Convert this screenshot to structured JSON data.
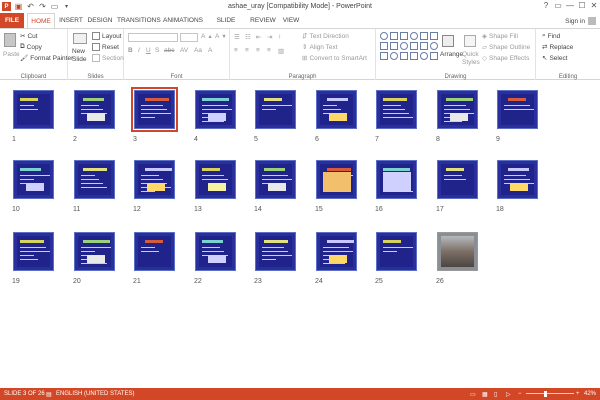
{
  "window": {
    "title": "ashae_uray [Compatibility Mode] - PowerPoint",
    "help": "?",
    "controls": [
      "▭",
      "—",
      "☐",
      "✕"
    ]
  },
  "account": {
    "label": "Sign in"
  },
  "tabs": [
    {
      "id": "file",
      "label": "FILE"
    },
    {
      "id": "home",
      "label": "HOME"
    },
    {
      "id": "insert",
      "label": "INSERT"
    },
    {
      "id": "design",
      "label": "DESIGN"
    },
    {
      "id": "transitions",
      "label": "TRANSITIONS"
    },
    {
      "id": "animations",
      "label": "ANIMATIONS"
    },
    {
      "id": "slideshow",
      "label": "SLIDE SHOW"
    },
    {
      "id": "review",
      "label": "REVIEW"
    },
    {
      "id": "view",
      "label": "VIEW"
    }
  ],
  "ribbon": {
    "clipboard": {
      "group": "Clipboard",
      "paste": "Paste",
      "cut": "Cut",
      "copy": "Copy",
      "format_painter": "Format Painter"
    },
    "slides": {
      "group": "Slides",
      "new_slide": "New",
      "new_slide_2": "Slide",
      "layout": "Layout",
      "reset": "Reset",
      "section": "Section"
    },
    "font": {
      "group": "Font",
      "aa": "Aa"
    },
    "paragraph": {
      "group": "Paragraph",
      "text_direction": "Text Direction",
      "align_text": "Align Text",
      "convert": "Convert to SmartArt"
    },
    "drawing": {
      "group": "Drawing",
      "arrange": "Arrange",
      "quick_styles": "Quick",
      "quick_styles_2": "Styles",
      "shape_fill": "Shape Fill",
      "shape_outline": "Shape Outline",
      "shape_effects": "Shape Effects"
    },
    "editing": {
      "group": "Editing",
      "find": "Find",
      "replace": "Replace",
      "select": "Select"
    }
  },
  "slides": [
    {
      "n": "1"
    },
    {
      "n": "2"
    },
    {
      "n": "3"
    },
    {
      "n": "4"
    },
    {
      "n": "5"
    },
    {
      "n": "6"
    },
    {
      "n": "7"
    },
    {
      "n": "8"
    },
    {
      "n": "9"
    },
    {
      "n": "10"
    },
    {
      "n": "11"
    },
    {
      "n": "12"
    },
    {
      "n": "13"
    },
    {
      "n": "14"
    },
    {
      "n": "15"
    },
    {
      "n": "16"
    },
    {
      "n": "17"
    },
    {
      "n": "18"
    },
    {
      "n": "19"
    },
    {
      "n": "20"
    },
    {
      "n": "21"
    },
    {
      "n": "22"
    },
    {
      "n": "23"
    },
    {
      "n": "24"
    },
    {
      "n": "25"
    },
    {
      "n": "26"
    }
  ],
  "selected_slide": 3,
  "status": {
    "slide": "SLIDE 3 OF 26",
    "language": "ENGLISH (UNITED STATES)",
    "zoom": "42%"
  },
  "colors": {
    "accent": "#d24726",
    "slide_bg": "#2a2f9e"
  }
}
